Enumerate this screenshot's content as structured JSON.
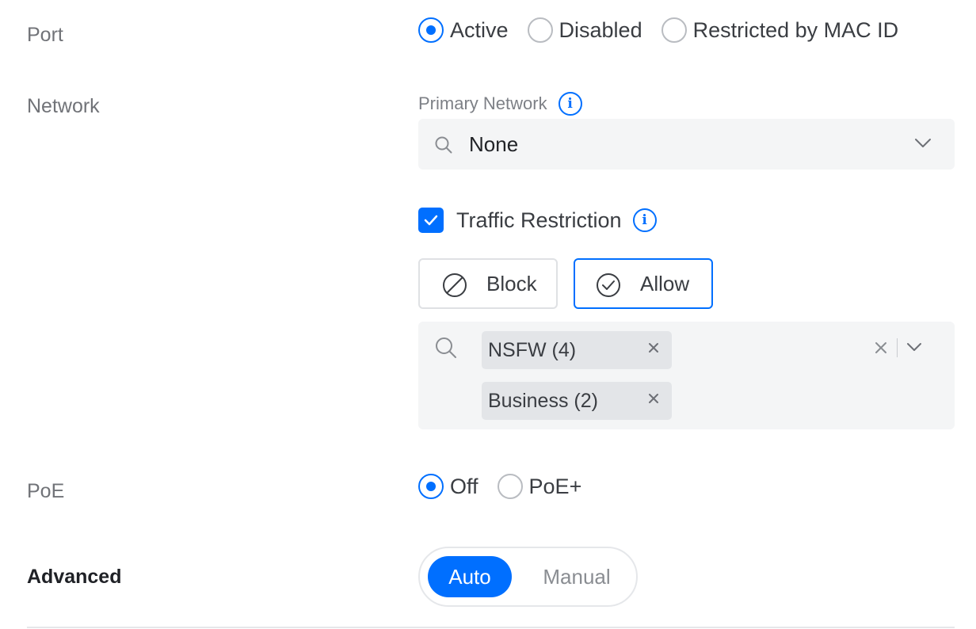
{
  "port": {
    "label": "Port",
    "options": [
      {
        "label": "Active",
        "selected": true
      },
      {
        "label": "Disabled",
        "selected": false
      },
      {
        "label": "Restricted by MAC ID",
        "selected": false
      }
    ]
  },
  "network": {
    "label": "Network",
    "primary_label": "Primary Network",
    "primary_info_icon": "info-icon",
    "primary_value": "None",
    "traffic_restriction": {
      "label": "Traffic Restriction",
      "checked": true,
      "info_icon": "info-icon",
      "modes": [
        {
          "label": "Block",
          "icon": "block-icon",
          "selected": false
        },
        {
          "label": "Allow",
          "icon": "allow-check-icon",
          "selected": true
        }
      ],
      "chips": [
        {
          "label": "NSFW (4)"
        },
        {
          "label": "Business (2)"
        }
      ]
    }
  },
  "poe": {
    "label": "PoE",
    "options": [
      {
        "label": "Off",
        "selected": true
      },
      {
        "label": "PoE+",
        "selected": false
      }
    ]
  },
  "advanced": {
    "label": "Advanced",
    "options": [
      {
        "label": "Auto",
        "selected": true
      },
      {
        "label": "Manual",
        "selected": false
      }
    ]
  },
  "colors": {
    "accent": "#006fff",
    "field_bg": "#f4f5f6",
    "chip_bg": "#e3e5e8"
  }
}
